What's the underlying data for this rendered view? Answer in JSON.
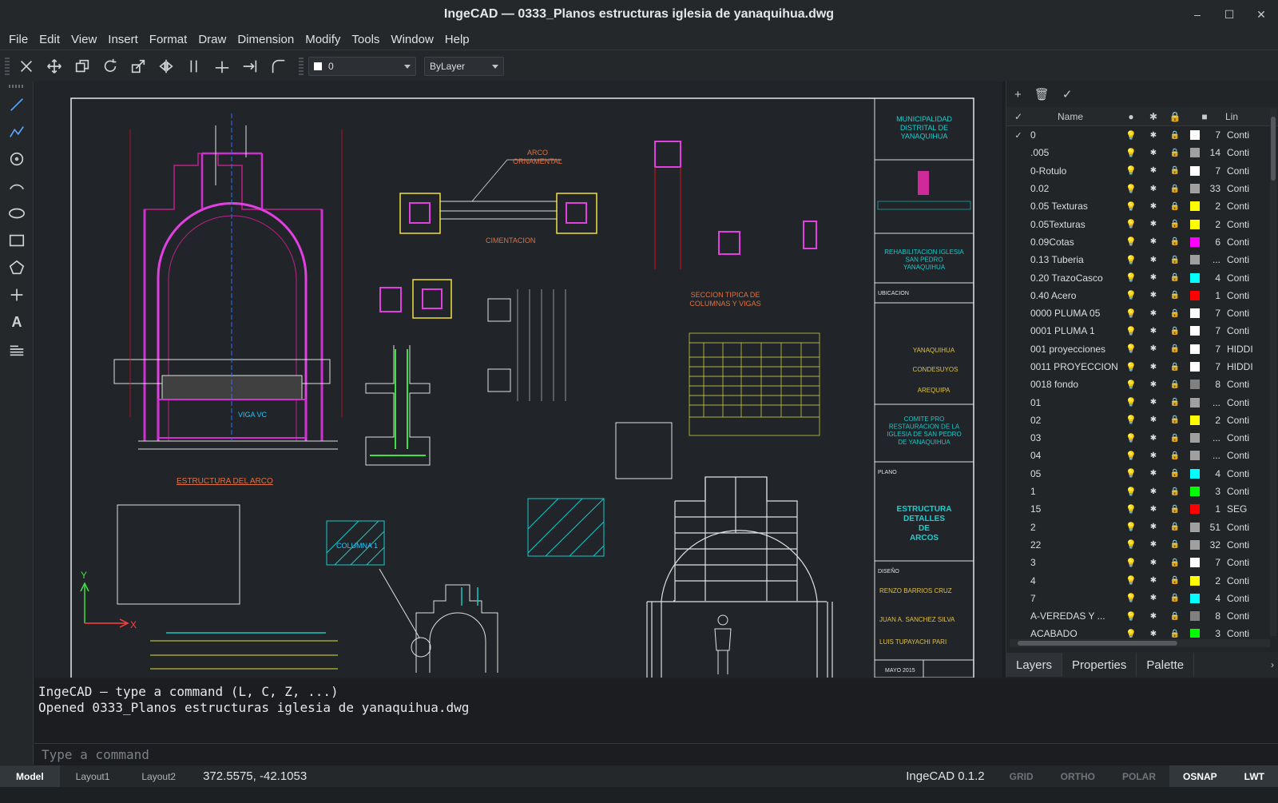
{
  "window": {
    "title": "IngeCAD — 0333_Planos estructuras iglesia de yanaquihua.dwg"
  },
  "menu": [
    "File",
    "Edit",
    "View",
    "Insert",
    "Format",
    "Draw",
    "Dimension",
    "Modify",
    "Tools",
    "Window",
    "Help"
  ],
  "toolbar": {
    "layer_value": "0",
    "linetype_value": "ByLayer"
  },
  "drawing": {
    "t_arco_orn": "ARCO\nORNAMENTAL",
    "t_cimentacion": "CIMENTACION",
    "t_seccion": "SECCION TIPICA DE\nCOLUMNAS Y VIGAS",
    "t_estructura_arco": "ESTRUCTURA DEL ARCO",
    "t_viga": "VIGA VC",
    "t_columna": "COLUMNA 1",
    "tb_muni": "MUNICIPALIDAD\nDISTRITAL DE\nYANAQUIHUA",
    "tb_obra": "REHABILITACION IGLESIA\nSAN PEDRO\nYANAQUIHUA",
    "tb_ubicacion": "UBICACION",
    "tb_loc1": "YANAQUIHUA",
    "tb_loc2": "CONDESUYOS",
    "tb_loc3": "AREQUIPA",
    "tb_propietario": "COMITE PRO\nRESTAURACION DE LA\nIGLESIA DE SAN PEDRO\nDE YANAQUIHUA",
    "tb_plano": "PLANO",
    "tb_titulo": "ESTRUCTURA\nDETALLES\nDE\nARCOS",
    "tb_diseno": "DISEÑO",
    "tb_name1": "RENZO BARRIOS CRUZ",
    "tb_name2": "JUAN A. SANCHEZ SILVA",
    "tb_name3": "LUIS TUPAYACHI PARI",
    "tb_fecha": "MAYO 2015",
    "axis_x": "X",
    "axis_y": "Y"
  },
  "layers_panel": {
    "header_name": "Name",
    "header_linetype": "Lin",
    "rows": [
      {
        "name": "0",
        "color": "#ffffff",
        "index": "7",
        "linetype": "Conti",
        "current": "✓"
      },
      {
        "name": ".005",
        "color": "#a0a0a0",
        "index": "14",
        "linetype": "Conti",
        "current": ""
      },
      {
        "name": "0-Rotulo",
        "color": "#ffffff",
        "index": "7",
        "linetype": "Conti",
        "current": ""
      },
      {
        "name": "0.02",
        "color": "#a0a0a0",
        "index": "33",
        "linetype": "Conti",
        "current": ""
      },
      {
        "name": "0.05 Texturas",
        "color": "#ffff00",
        "index": "2",
        "linetype": "Conti",
        "current": ""
      },
      {
        "name": "0.05Texturas",
        "color": "#ffff00",
        "index": "2",
        "linetype": "Conti",
        "current": ""
      },
      {
        "name": "0.09Cotas",
        "color": "#ff00ff",
        "index": "6",
        "linetype": "Conti",
        "current": ""
      },
      {
        "name": "0.13 Tuberia",
        "color": "#a0a0a0",
        "index": "...",
        "linetype": "Conti",
        "current": ""
      },
      {
        "name": "0.20 TrazoCasco",
        "color": "#00ffff",
        "index": "4",
        "linetype": "Conti",
        "current": ""
      },
      {
        "name": "0.40 Acero",
        "color": "#ff0000",
        "index": "1",
        "linetype": "Conti",
        "current": ""
      },
      {
        "name": "0000 PLUMA 05",
        "color": "#ffffff",
        "index": "7",
        "linetype": "Conti",
        "current": ""
      },
      {
        "name": "0001 PLUMA 1",
        "color": "#ffffff",
        "index": "7",
        "linetype": "Conti",
        "current": ""
      },
      {
        "name": "001 proyecciones",
        "color": "#ffffff",
        "index": "7",
        "linetype": "HIDDI",
        "current": ""
      },
      {
        "name": "0011 PROYECCION",
        "color": "#ffffff",
        "index": "7",
        "linetype": "HIDDI",
        "current": ""
      },
      {
        "name": "0018 fondo",
        "color": "#808080",
        "index": "8",
        "linetype": "Conti",
        "current": ""
      },
      {
        "name": "01",
        "color": "#a0a0a0",
        "index": "...",
        "linetype": "Conti",
        "current": ""
      },
      {
        "name": "02",
        "color": "#ffff00",
        "index": "2",
        "linetype": "Conti",
        "current": ""
      },
      {
        "name": "03",
        "color": "#a0a0a0",
        "index": "...",
        "linetype": "Conti",
        "current": ""
      },
      {
        "name": "04",
        "color": "#a0a0a0",
        "index": "...",
        "linetype": "Conti",
        "current": ""
      },
      {
        "name": "05",
        "color": "#00ffff",
        "index": "4",
        "linetype": "Conti",
        "current": ""
      },
      {
        "name": "1",
        "color": "#00ff00",
        "index": "3",
        "linetype": "Conti",
        "current": ""
      },
      {
        "name": "15",
        "color": "#ff0000",
        "index": "1",
        "linetype": "SEG",
        "current": ""
      },
      {
        "name": "2",
        "color": "#a0a0a0",
        "index": "51",
        "linetype": "Conti",
        "current": ""
      },
      {
        "name": "22",
        "color": "#a0a0a0",
        "index": "32",
        "linetype": "Conti",
        "current": ""
      },
      {
        "name": "3",
        "color": "#ffffff",
        "index": "7",
        "linetype": "Conti",
        "current": ""
      },
      {
        "name": "4",
        "color": "#ffff00",
        "index": "2",
        "linetype": "Conti",
        "current": ""
      },
      {
        "name": "7",
        "color": "#00ffff",
        "index": "4",
        "linetype": "Conti",
        "current": ""
      },
      {
        "name": "A-VEREDAS Y ...",
        "color": "#808080",
        "index": "8",
        "linetype": "Conti",
        "current": ""
      },
      {
        "name": "ACABADO",
        "color": "#00ff00",
        "index": "3",
        "linetype": "Conti",
        "current": ""
      }
    ]
  },
  "panel_tabs": [
    "Layers",
    "Properties",
    "Palette"
  ],
  "command": {
    "line1": "IngeCAD — type a command (L, C, Z, ...)",
    "line2": "Opened 0333_Planos estructuras iglesia de yanaquihua.dwg",
    "placeholder": "Type a command"
  },
  "status": {
    "tabs": [
      "Model",
      "Layout1",
      "Layout2"
    ],
    "coords": "372.5575, -42.1053",
    "version": "IngeCAD 0.1.2",
    "toggles": [
      {
        "label": "GRID",
        "on": false
      },
      {
        "label": "ORTHO",
        "on": false
      },
      {
        "label": "POLAR",
        "on": false
      },
      {
        "label": "OSNAP",
        "on": true
      },
      {
        "label": "LWT",
        "on": true
      }
    ]
  }
}
